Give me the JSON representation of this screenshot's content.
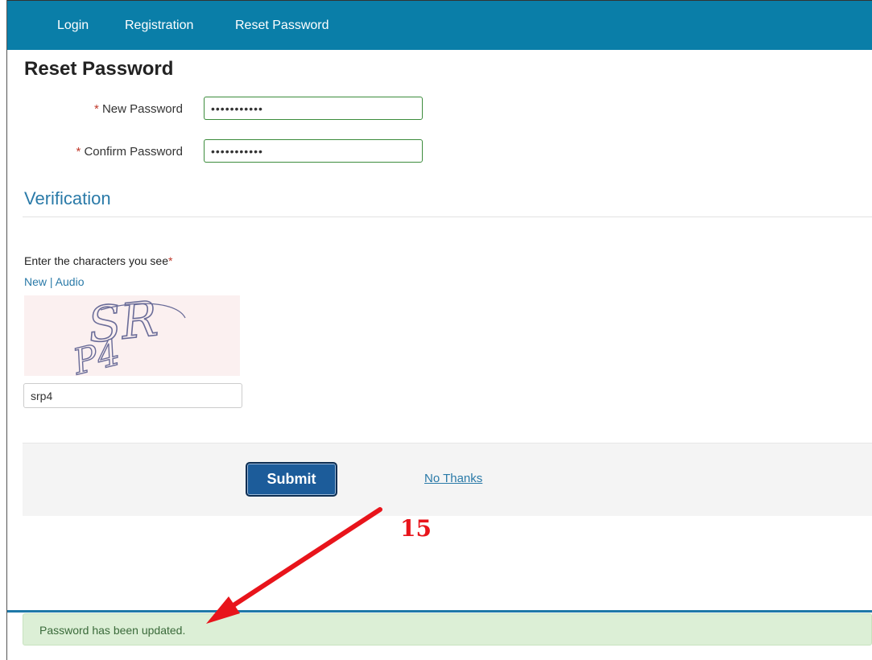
{
  "nav": {
    "items": [
      {
        "label": "Login"
      },
      {
        "label": "Registration"
      },
      {
        "label": "Reset Password"
      }
    ]
  },
  "page": {
    "title": "Reset Password"
  },
  "form": {
    "required_marker": "*",
    "new_password": {
      "label": "New Password",
      "value": "•••••••••••"
    },
    "confirm_password": {
      "label": "Confirm Password",
      "value": "•••••••••••"
    }
  },
  "verification": {
    "title": "Verification",
    "prompt": "Enter the characters you see",
    "required_marker": "*",
    "new_link": "New",
    "separator": "|",
    "audio_link": "Audio",
    "captcha_text": "SRP4",
    "input_value": "srp4"
  },
  "actions": {
    "submit_label": "Submit",
    "no_thanks_label": "No Thanks"
  },
  "annotation": {
    "step_number": "15"
  },
  "status": {
    "message": "Password has been updated."
  },
  "colors": {
    "nav_bg": "#0a7ea8",
    "accent": "#2a7aa8",
    "success_bg": "#dcefd6",
    "annotation_red": "#e8141b"
  }
}
